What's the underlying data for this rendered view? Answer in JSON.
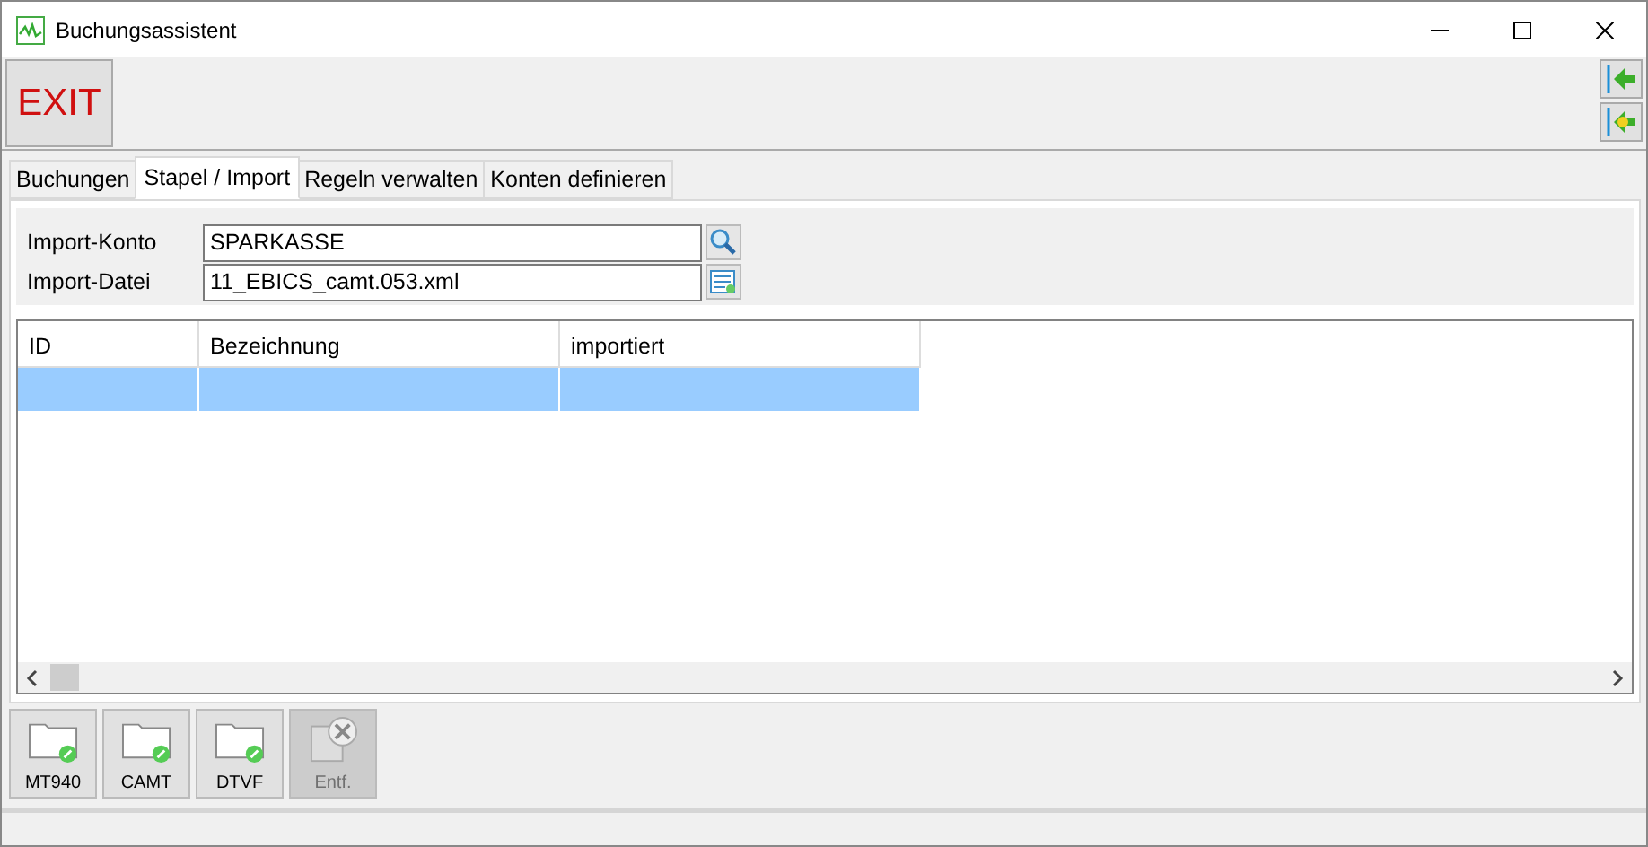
{
  "window": {
    "title": "Buchungsassistent"
  },
  "toolbar": {
    "exit_label": "EXIT"
  },
  "side_buttons": [
    {
      "kind": "back"
    },
    {
      "kind": "import"
    }
  ],
  "tabs": [
    {
      "label": "Buchungen",
      "selected": false
    },
    {
      "label": "Stapel / Import",
      "selected": true
    },
    {
      "label": "Regeln verwalten",
      "selected": false
    },
    {
      "label": "Konten definieren",
      "selected": false
    }
  ],
  "form": [
    {
      "label": "Import-Konto",
      "value": "SPARKASSE",
      "kind": "search"
    },
    {
      "label": "Import-Datei",
      "value": "11_EBICS_camt.053.xml",
      "kind": "file"
    }
  ],
  "table": {
    "columns": [
      "ID",
      "Bezeichnung",
      "importiert"
    ],
    "rows": [
      {
        "selected": true
      }
    ]
  },
  "actions": [
    {
      "label": "MT940",
      "kind": "folder",
      "disabled": false
    },
    {
      "label": "CAMT",
      "kind": "folder",
      "disabled": false
    },
    {
      "label": "DTVF",
      "kind": "folder",
      "disabled": false
    },
    {
      "label": "Entf.",
      "kind": "delete",
      "disabled": true
    }
  ]
}
